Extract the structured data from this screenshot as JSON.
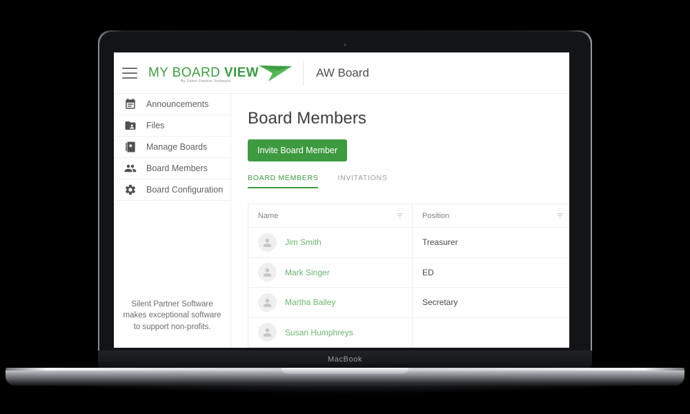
{
  "device": {
    "model_label": "MacBook"
  },
  "header": {
    "menu_icon": "hamburger-icon",
    "logo_line1_light": "MY BOARD ",
    "logo_line1_bold": "VIEW",
    "logo_tagline": "By Silent Partner Software",
    "board_title": "AW Board"
  },
  "sidebar": {
    "items": [
      {
        "label": "Announcements",
        "icon": "calendar-icon"
      },
      {
        "label": "Files",
        "icon": "folder-shared-icon"
      },
      {
        "label": "Manage Boards",
        "icon": "contact-page-icon"
      },
      {
        "label": "Board Members",
        "icon": "people-icon"
      },
      {
        "label": "Board Configuration",
        "icon": "gear-icon"
      }
    ],
    "footer_text": "Silent Partner Software makes exceptional software to support non-profits."
  },
  "main": {
    "page_title": "Board Members",
    "invite_button": "Invite Board Member",
    "tabs": [
      {
        "label": "BOARD MEMBERS",
        "active": true
      },
      {
        "label": "INVITATIONS",
        "active": false
      }
    ],
    "table": {
      "columns": [
        "Name",
        "Position"
      ],
      "rows": [
        {
          "name": "Jim Smith",
          "position": "Treasurer"
        },
        {
          "name": "Mark Singer",
          "position": "ED"
        },
        {
          "name": "Martha Bailey",
          "position": "Secretary"
        },
        {
          "name": "Susan Humphreys",
          "position": ""
        }
      ]
    }
  },
  "colors": {
    "brand_green": "#3e9b43",
    "button_green": "#3d9a40",
    "link_green": "#6cb46f",
    "text_dark": "#45484a",
    "text_muted": "#7d8082"
  }
}
